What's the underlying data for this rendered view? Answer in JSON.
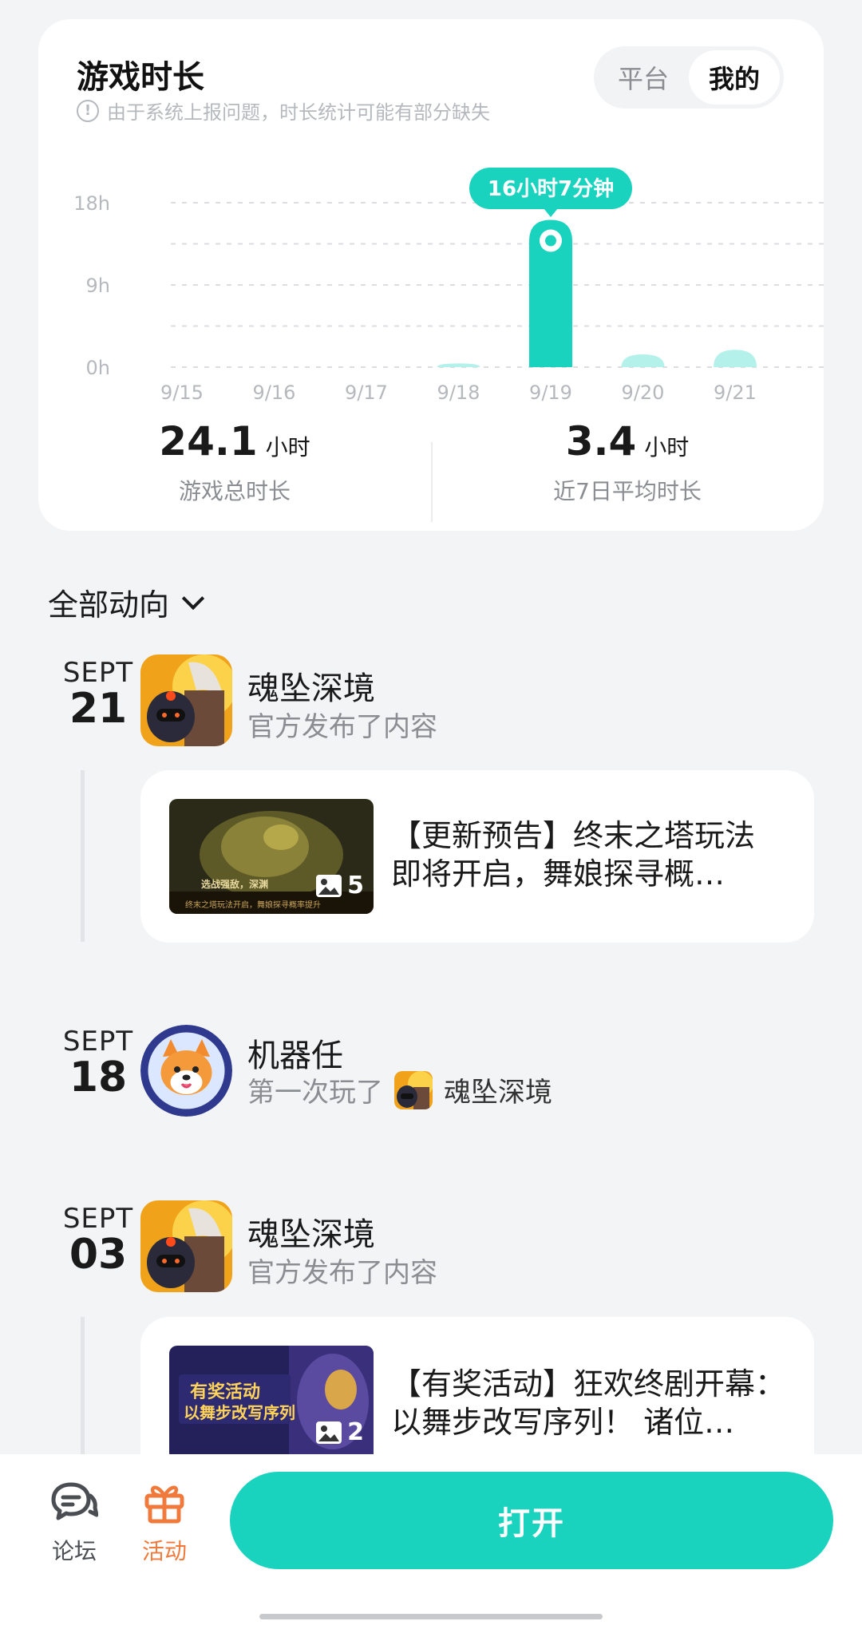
{
  "playtime": {
    "title": "游戏时长",
    "notice": "由于系统上报问题，时长统计可能有部分缺失",
    "segments": [
      "平台",
      "我的"
    ],
    "active_segment": "我的",
    "tooltip": "16小时7分钟",
    "total_value": "24.1",
    "total_unit": "小时",
    "total_label": "游戏总时长",
    "avg_value": "3.4",
    "avg_unit": "小时",
    "avg_label": "近7日平均时长"
  },
  "chart_data": {
    "type": "bar",
    "categories": [
      "9/15",
      "9/16",
      "9/17",
      "9/18",
      "9/19",
      "9/20",
      "9/21"
    ],
    "values": [
      0,
      0,
      0,
      0.4,
      16.12,
      1.4,
      1.9
    ],
    "highlight_index": 4,
    "y_ticks": [
      "18h",
      "9h",
      "0h"
    ],
    "y_tick_values": [
      18,
      9,
      0
    ],
    "ylim": [
      0,
      18
    ],
    "grid": true,
    "colors": {
      "highlight": "#19d3bf",
      "normal": "#b3f1ea",
      "grid": "#dcdde0",
      "tick": "#b5b8bd"
    }
  },
  "feed": {
    "filter_label": "全部动向",
    "entries": [
      {
        "month": "SEPT",
        "day": "21",
        "name": "魂坠深境",
        "desc": "官方发布了内容",
        "post_title": "【更新预告】终末之塔玩法\n即将开启，舞娘探寻概…",
        "post_image_count": "5",
        "thumb_caption_top": "选战强敌，深渊",
        "thumb_caption_bottom": "终末之塔玩法开启，舞娘探寻概率提升"
      },
      {
        "month": "SEPT",
        "day": "18",
        "name": "机器任",
        "desc": "第一次玩了",
        "game": "魂坠深境"
      },
      {
        "month": "SEPT",
        "day": "03",
        "name": "魂坠深境",
        "desc": "官方发布了内容",
        "post_title": "【有奖活动】狂欢终剧开幕：\n以舞步改写序列！ 诸位…",
        "post_image_count": "2",
        "thumb_caption_top": "有奖活动",
        "thumb_caption_bottom": "以舞步改写序列"
      }
    ]
  },
  "bottom_bar": {
    "forum_label": "论坛",
    "activity_label": "活动",
    "open_label": "打开",
    "colors": {
      "accent": "#19d3bf",
      "activity": "#f07a3c",
      "forum": "#4a4d52"
    }
  }
}
